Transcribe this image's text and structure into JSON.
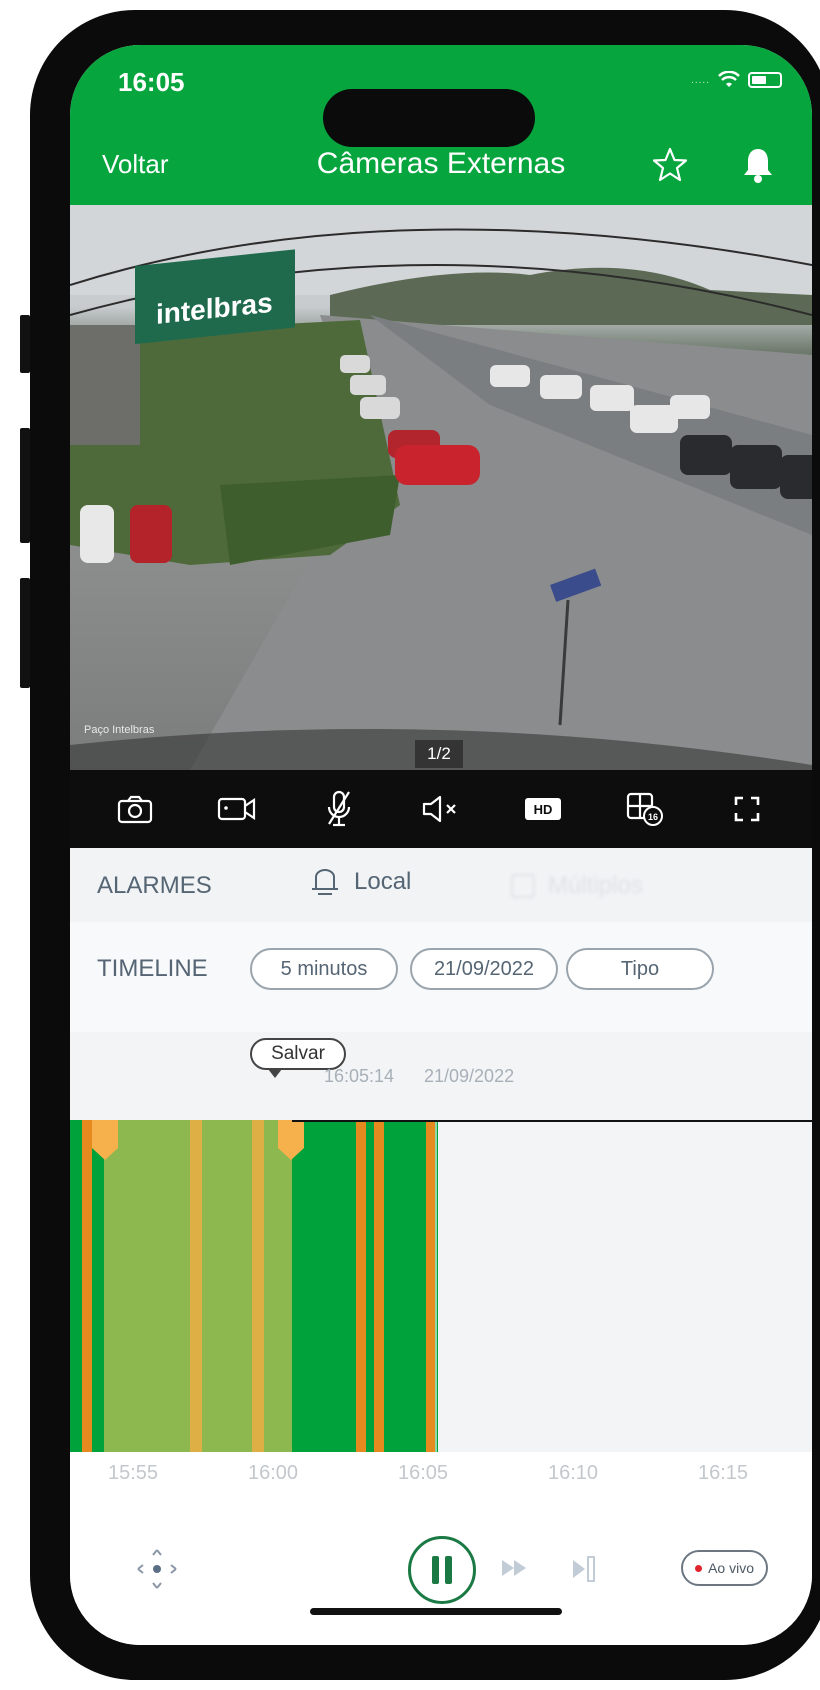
{
  "status_bar": {
    "time": "16:05",
    "signal": "....."
  },
  "header": {
    "back_label": "Voltar",
    "title": "Câmeras Externas"
  },
  "camera": {
    "brand_sign": "intelbras",
    "watermark": "Paço Intelbras",
    "page_indicator": "1/2"
  },
  "toolbar": {
    "items": [
      "camera-icon",
      "record-video-icon",
      "mic-off-icon",
      "speaker-muted-icon",
      "hd-icon",
      "grid-16-icon",
      "fullscreen-icon"
    ],
    "hd_label": "HD",
    "grid_badge": "16"
  },
  "tabs": {
    "alarmes": "ALARMES",
    "local": "Local",
    "multiplos": "Múltiplos"
  },
  "timeline": {
    "label": "TIMELINE",
    "interval": "5 minutos",
    "date": "21/09/2022",
    "type_label": "Tipo",
    "save_label": "Salvar",
    "cursor_time": "16:05:14",
    "cursor_date": "21/09/2022",
    "ticks": [
      "15:55",
      "16:00",
      "16:05",
      "16:10",
      "16:15"
    ]
  },
  "playback": {
    "live_label": "Ao vivo"
  },
  "colors": {
    "header_green": "#06a53d",
    "recording_green": "#00a23b",
    "event_orange": "#e58a1f",
    "selection_yellow": "#f6b04c"
  }
}
